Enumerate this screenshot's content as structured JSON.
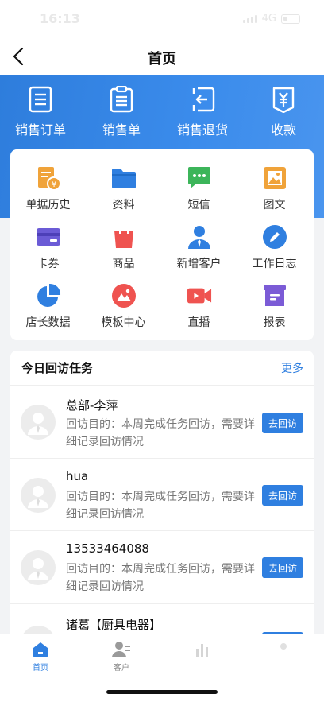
{
  "status": {
    "time": "16:13",
    "network": "4G"
  },
  "nav": {
    "title": "首页"
  },
  "quick_actions": [
    {
      "label": "销售订单",
      "icon": "document-list-icon"
    },
    {
      "label": "销售单",
      "icon": "clipboard-icon"
    },
    {
      "label": "销售退货",
      "icon": "return-icon"
    },
    {
      "label": "收款",
      "icon": "yen-receipt-icon"
    }
  ],
  "grid": [
    {
      "label": "单据历史",
      "icon": "bill-history-icon",
      "color": "#f0a33a"
    },
    {
      "label": "资料",
      "icon": "folder-icon",
      "color": "#2f7fe0"
    },
    {
      "label": "短信",
      "icon": "message-icon",
      "color": "#3cb55a"
    },
    {
      "label": "图文",
      "icon": "image-icon",
      "color": "#f0a33a"
    },
    {
      "label": "卡券",
      "icon": "card-icon",
      "color": "#6b5bd6"
    },
    {
      "label": "商品",
      "icon": "shopping-bag-icon",
      "color": "#ef5350"
    },
    {
      "label": "新增客户",
      "icon": "add-customer-icon",
      "color": "#2f7fe0"
    },
    {
      "label": "工作日志",
      "icon": "pencil-icon",
      "color": "#2f7fe0"
    },
    {
      "label": "店长数据",
      "icon": "pie-chart-icon",
      "color": "#2f7fe0"
    },
    {
      "label": "模板中心",
      "icon": "template-icon",
      "color": "#ef5350"
    },
    {
      "label": "直播",
      "icon": "video-camera-icon",
      "color": "#ef5350"
    },
    {
      "label": "报表",
      "icon": "report-box-icon",
      "color": "#7b5bd6"
    }
  ],
  "tasks": {
    "title": "今日回访任务",
    "more": "更多",
    "button_label": "去回访",
    "items": [
      {
        "name": "总部-李萍",
        "desc": "回访目的：本周完成任务回访，需要详细记录回访情况"
      },
      {
        "name": "hua",
        "desc": "回访目的：本周完成任务回访，需要详细记录回访情况"
      },
      {
        "name": "13533464088",
        "desc": "回访目的：本周完成任务回访，需要详细记录回访情况"
      },
      {
        "name": "诸葛【厨具电器】",
        "desc": ""
      }
    ]
  },
  "tabs": [
    {
      "label": "首页",
      "icon": "home-icon",
      "active": true
    },
    {
      "label": "客户",
      "icon": "customer-icon",
      "active": false
    },
    {
      "label": "",
      "icon": "chart-icon",
      "active": false
    },
    {
      "label": "",
      "icon": "profile-icon",
      "active": false
    }
  ]
}
